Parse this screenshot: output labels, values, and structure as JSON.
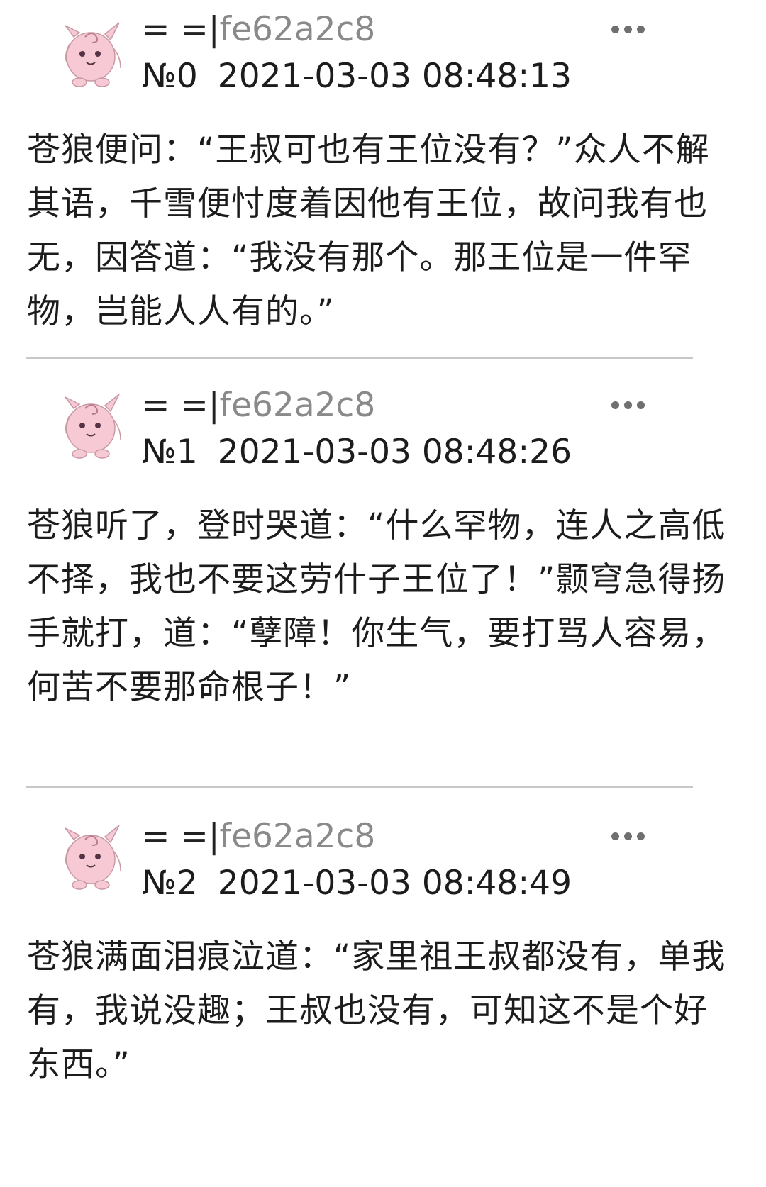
{
  "posts": [
    {
      "user_prefix": "= =|",
      "user_id": "fe62a2c8",
      "number": "№0",
      "timestamp": "2021-03-03 08:48:13",
      "content": "苍狼便问：“王叔可也有王位没有？”众人不解其语，千雪便忖度着因他有王位，故问我有也无，因答道：“我没有那个。那王位是一件罕物，岂能人人有的。”"
    },
    {
      "user_prefix": "= =|",
      "user_id": "fe62a2c8",
      "number": "№1",
      "timestamp": "2021-03-03 08:48:26",
      "content": "苍狼听了，登时哭道：“什么罕物，连人之高低不择，我也不要这劳什子王位了！”颢穹急得扬手就打，道：“孽障！你生气，要打骂人容易，何苦不要那命根子！”"
    },
    {
      "user_prefix": "= =|",
      "user_id": "fe62a2c8",
      "number": "№2",
      "timestamp": "2021-03-03 08:48:49",
      "content": "苍狼满面泪痕泣道：“家里祖王叔都没有，单我有，我说没趣；王叔也没有，可知这不是个好东西。”"
    }
  ],
  "icons": {
    "avatar": "pink-puffball-avatar-icon",
    "more": "more-dots-icon"
  },
  "colors": {
    "user_id": "#8a8a8a",
    "divider": "#c8c8c8",
    "avatar": "#f6c9d4"
  }
}
